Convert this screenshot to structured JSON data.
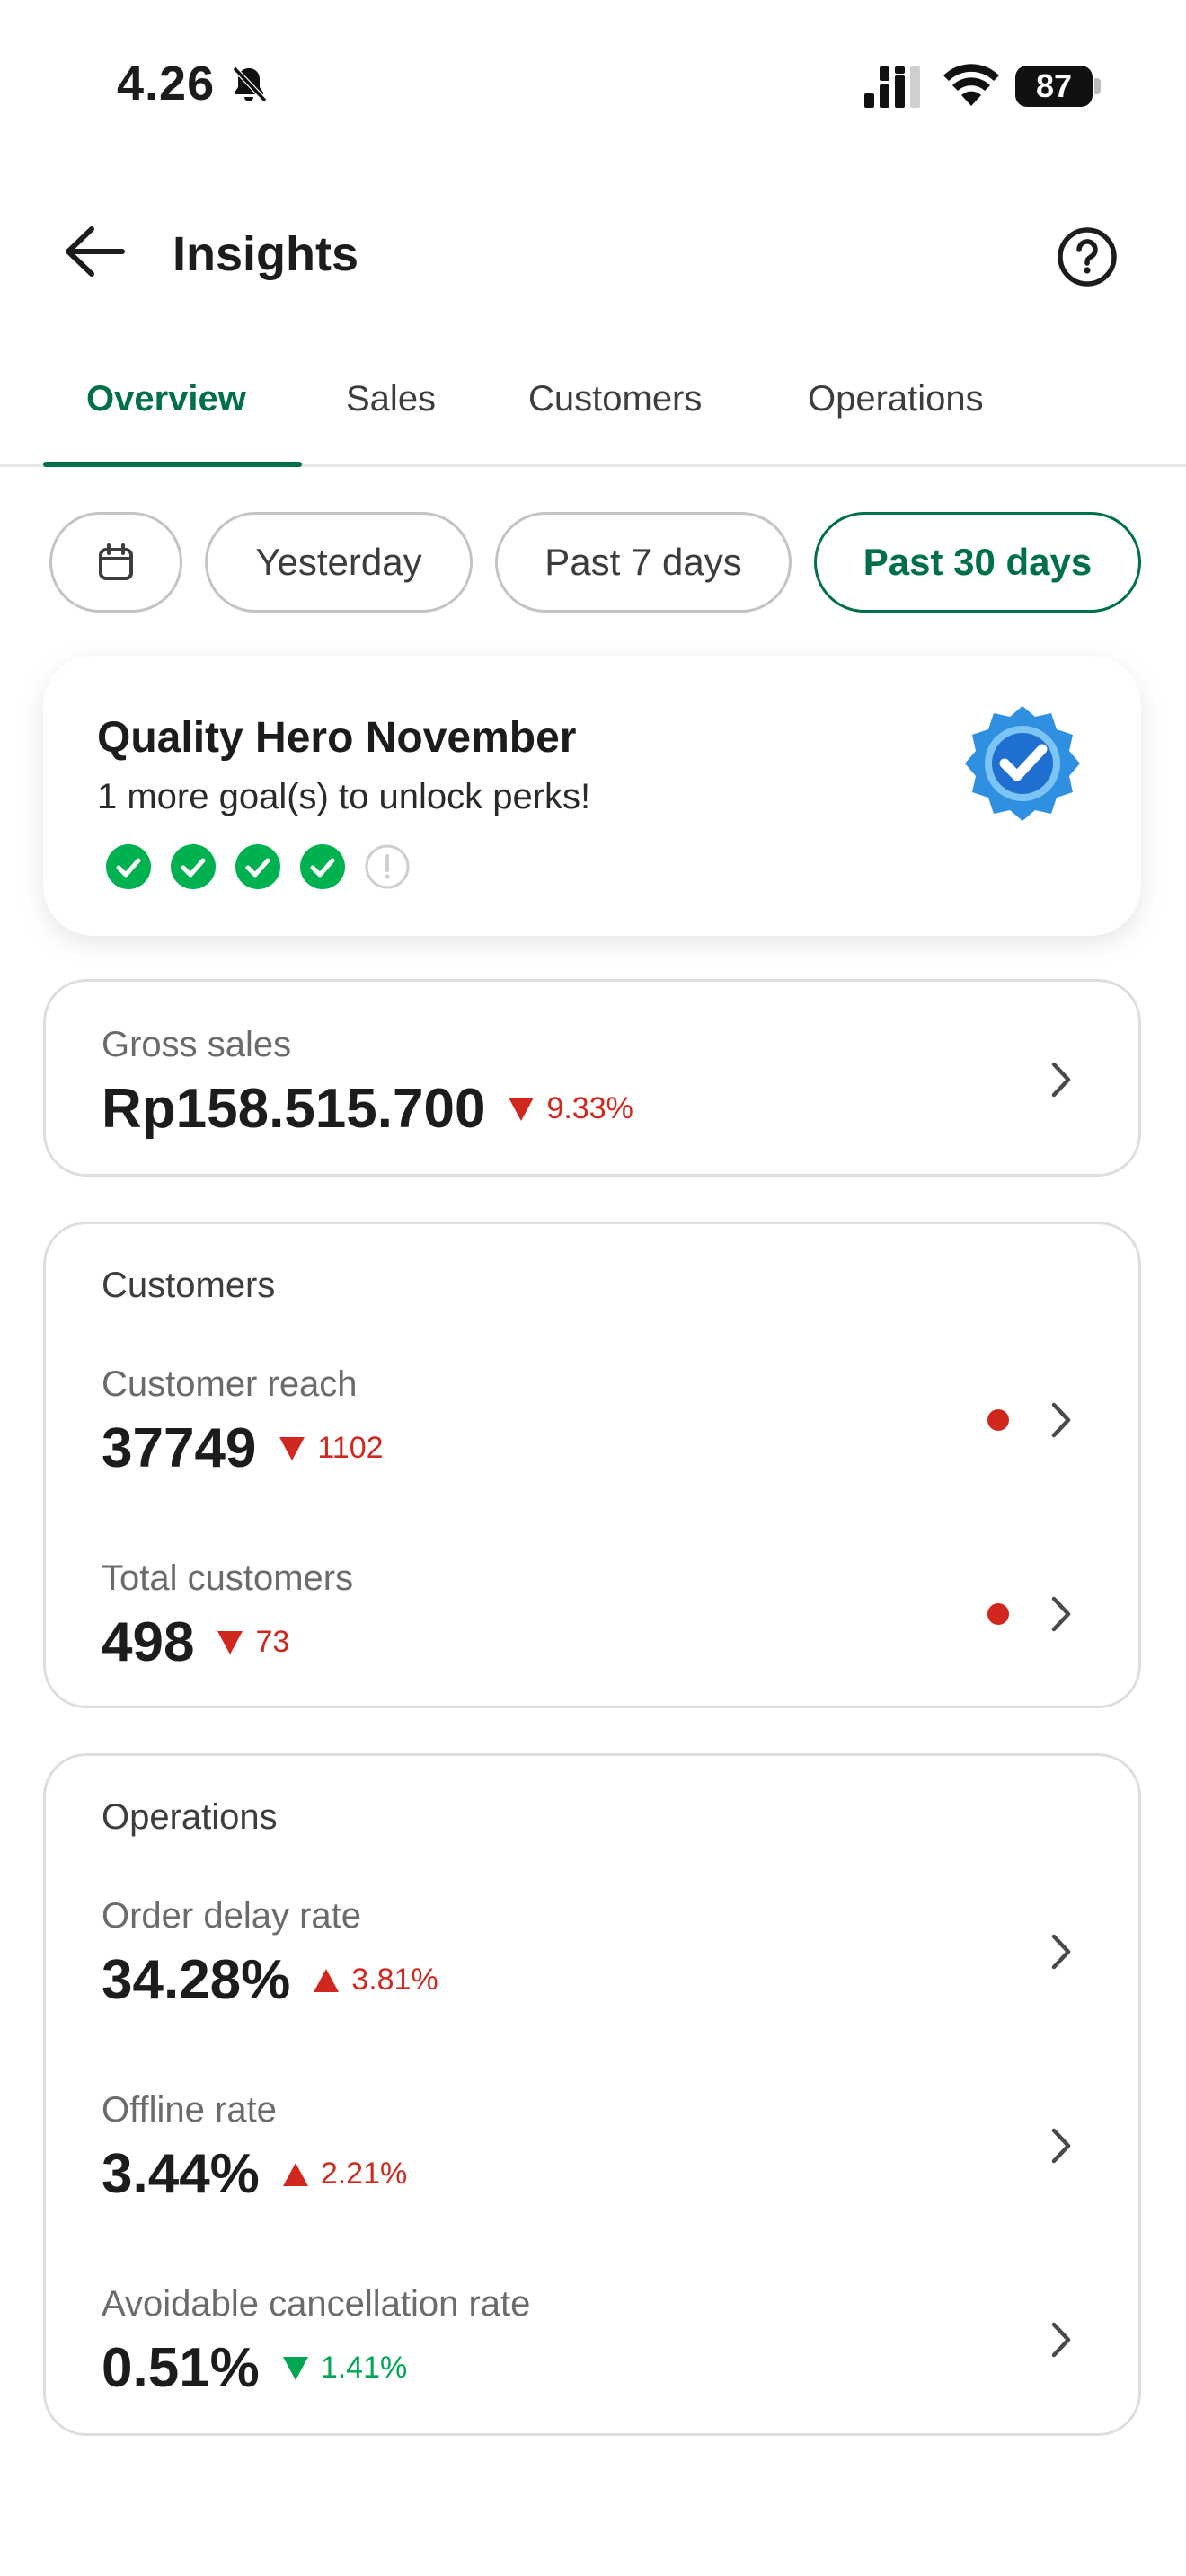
{
  "status_bar": {
    "time": "4.26",
    "battery": "87"
  },
  "header": {
    "title": "Insights"
  },
  "tabs": [
    {
      "label": "Overview",
      "active": true
    },
    {
      "label": "Sales",
      "active": false
    },
    {
      "label": "Customers",
      "active": false
    },
    {
      "label": "Operations",
      "active": false
    }
  ],
  "filters": {
    "chips": [
      {
        "label": "Yesterday",
        "active": false
      },
      {
        "label": "Past 7 days",
        "active": false
      },
      {
        "label": "Past 30 days",
        "active": true
      }
    ]
  },
  "quality_hero": {
    "title": "Quality Hero November",
    "subtitle": "1 more goal(s) to unlock perks!",
    "goals": [
      "done",
      "done",
      "done",
      "done",
      "pending"
    ]
  },
  "gross_sales": {
    "label": "Gross sales",
    "value": "Rp158.515.700",
    "delta": "9.33%",
    "delta_direction": "down"
  },
  "customers": {
    "title": "Customers",
    "metrics": [
      {
        "label": "Customer reach",
        "value": "37749",
        "delta": "1102",
        "delta_direction": "down",
        "alert": true
      },
      {
        "label": "Total customers",
        "value": "498",
        "delta": "73",
        "delta_direction": "down",
        "alert": true
      }
    ]
  },
  "operations": {
    "title": "Operations",
    "metrics": [
      {
        "label": "Order delay rate",
        "value": "34.28%",
        "delta": "3.81%",
        "delta_direction": "up"
      },
      {
        "label": "Offline rate",
        "value": "3.44%",
        "delta": "2.21%",
        "delta_direction": "up"
      },
      {
        "label": "Avoidable cancellation rate",
        "value": "0.51%",
        "delta": "1.41%",
        "delta_direction": "down"
      }
    ]
  },
  "colors": {
    "brand_green": "#00704a",
    "goal_green": "#00b14f",
    "negative_red": "#d0281e",
    "positive_green": "#00a651",
    "badge_blue": "#2f8fe0"
  },
  "icons": {
    "back": "arrow-left-icon",
    "help": "question-circle-icon",
    "calendar": "calendar-icon",
    "chevron": "chevron-right-icon",
    "badge": "verified-badge-icon"
  }
}
